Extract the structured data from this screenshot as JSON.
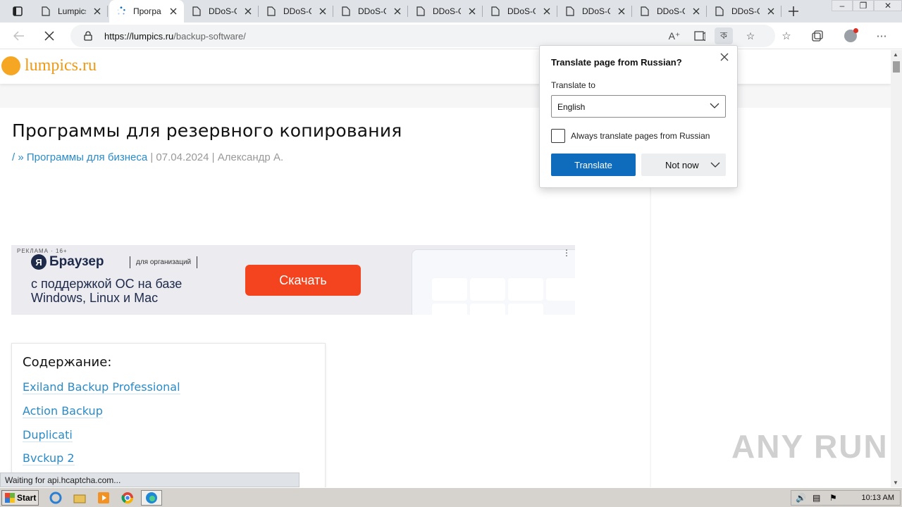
{
  "tabs": [
    {
      "title": "Lumpics",
      "active": false
    },
    {
      "title": "Програ",
      "active": true
    },
    {
      "title": "DDoS-G",
      "active": false
    },
    {
      "title": "DDoS-G",
      "active": false
    },
    {
      "title": "DDoS-G",
      "active": false
    },
    {
      "title": "DDoS-G",
      "active": false
    },
    {
      "title": "DDoS-G",
      "active": false
    },
    {
      "title": "DDoS-G",
      "active": false
    },
    {
      "title": "DDoS-G",
      "active": false
    },
    {
      "title": "DDoS-G",
      "active": false
    }
  ],
  "address": {
    "domain": "https://lumpics.ru",
    "path": "/backup-software/"
  },
  "site": {
    "logo_text": "lumpics.ru"
  },
  "article": {
    "title": "Программы для резервного копирования",
    "meta_home": "/",
    "meta_sep": " » ",
    "meta_category": "Программы для бизнеса",
    "meta_date": "07.04.2024",
    "meta_author": "Александр А."
  },
  "ad": {
    "label": "РЕКЛАМА · 16+",
    "brand": "Браузер",
    "brand_badge": "Я",
    "org": "для организаций",
    "line1": "с поддержкой ОС на базе",
    "line2": "Windows, Linux и Mac",
    "cta": "Скачать"
  },
  "toc": {
    "title": "Содержание:",
    "items": [
      "Exiland Backup Professional",
      "Action Backup",
      "Duplicati",
      "Bvckup 2"
    ]
  },
  "status_text": "Waiting for api.hcaptcha.com...",
  "watermark": "ANY RUN",
  "translate_popup": {
    "title": "Translate page from Russian?",
    "translate_to_label": "Translate to",
    "selected_language": "English",
    "always_label": "Always translate pages from Russian",
    "always_checked": false,
    "translate_button": "Translate",
    "not_now_button": "Not now"
  },
  "taskbar": {
    "start_label": "Start",
    "clock": "10:13 AM"
  },
  "colors": {
    "accent": "#0f6cbd",
    "link": "#2a8bc8",
    "logo": "#f09a14",
    "ad_cta": "#f4441f"
  }
}
